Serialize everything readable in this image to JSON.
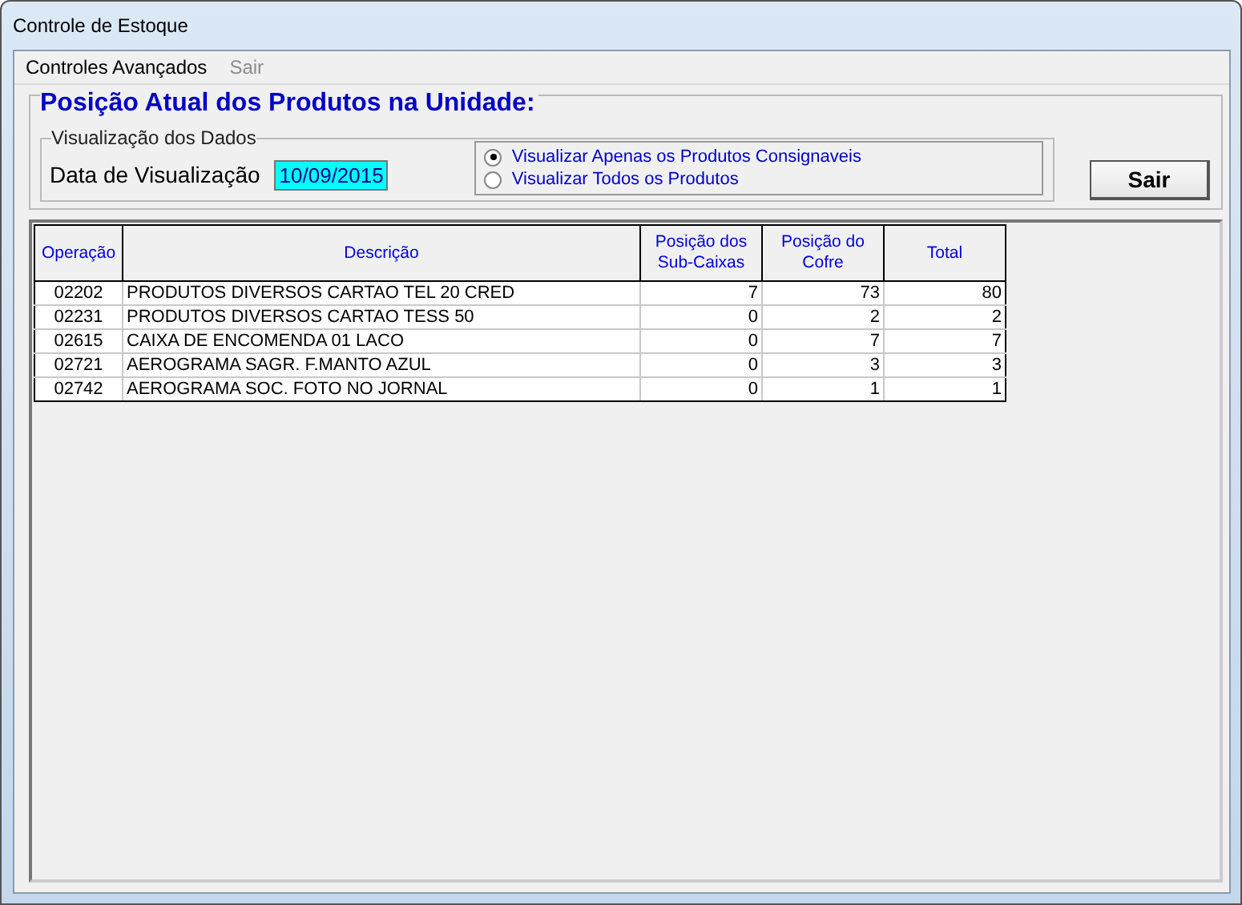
{
  "window": {
    "title": "Controle de Estoque"
  },
  "menu": [
    {
      "label": "Controles Avançados",
      "disabled": false
    },
    {
      "label": "Sair",
      "disabled": true
    }
  ],
  "heading": "Posição Atual dos Produtos na Unidade:",
  "group": {
    "title": "Visualização dos Dados",
    "date_label": "Data de Visualização",
    "date_value": "10/09/2015"
  },
  "options": [
    {
      "label": "Visualizar Apenas os Produtos Consignaveis",
      "selected": true
    },
    {
      "label": "Visualizar Todos os Produtos",
      "selected": false
    }
  ],
  "exit_button": "Sair",
  "table": {
    "columns": [
      "Operação",
      "Descrição",
      "Posição dos Sub-Caixas",
      "Posição do Cofre",
      "Total"
    ],
    "rows": [
      [
        "02202",
        "PRODUTOS DIVERSOS CARTAO TEL 20 CRED",
        "7",
        "73",
        "80"
      ],
      [
        "02231",
        "PRODUTOS DIVERSOS CARTAO TESS 50",
        "0",
        "2",
        "2"
      ],
      [
        "02615",
        "CAIXA DE ENCOMENDA 01 LACO",
        "0",
        "7",
        "7"
      ],
      [
        "02721",
        "AEROGRAMA SAGR. F.MANTO AZUL",
        "0",
        "3",
        "3"
      ],
      [
        "02742",
        "AEROGRAMA SOC. FOTO NO JORNAL",
        "0",
        "1",
        "1"
      ]
    ]
  }
}
